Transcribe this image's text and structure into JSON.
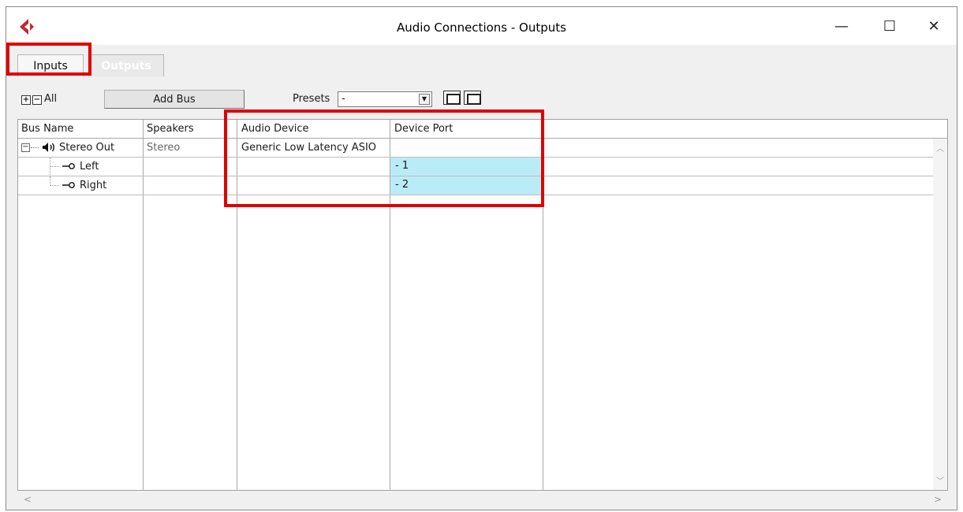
{
  "window": {
    "title": "Audio Connections - Outputs",
    "controls": {
      "minimize": "—",
      "maximize": "☐",
      "close": "✕"
    },
    "logo_icon": "cubase-logo-icon"
  },
  "tabs": [
    {
      "label": "Inputs",
      "selected": false
    },
    {
      "label": "Outputs",
      "selected": true
    }
  ],
  "toolbar": {
    "expand_all": "+",
    "collapse_all": "−",
    "all_label": "All",
    "add_bus_label": "Add Bus",
    "presets_label": "Presets",
    "presets_value": "-",
    "preset_icons": [
      "store-preset-icon",
      "remove-preset-icon"
    ]
  },
  "table": {
    "columns": [
      "Bus Name",
      "Speakers",
      "Audio Device",
      "Device Port"
    ],
    "rows": [
      {
        "bus_name": "Stereo Out",
        "speakers": "Stereo",
        "audio_device": "Generic Low Latency ASIO",
        "device_port": ""
      },
      {
        "bus_name": "Left",
        "speakers": "",
        "audio_device": "",
        "device_port": "- 1"
      },
      {
        "bus_name": "Right",
        "speakers": "",
        "audio_device": "",
        "device_port": "- 2"
      }
    ]
  },
  "colors": {
    "highlight": "#e00000",
    "port_selected": "#b9ecf7",
    "logo_red": "#c0272d"
  }
}
